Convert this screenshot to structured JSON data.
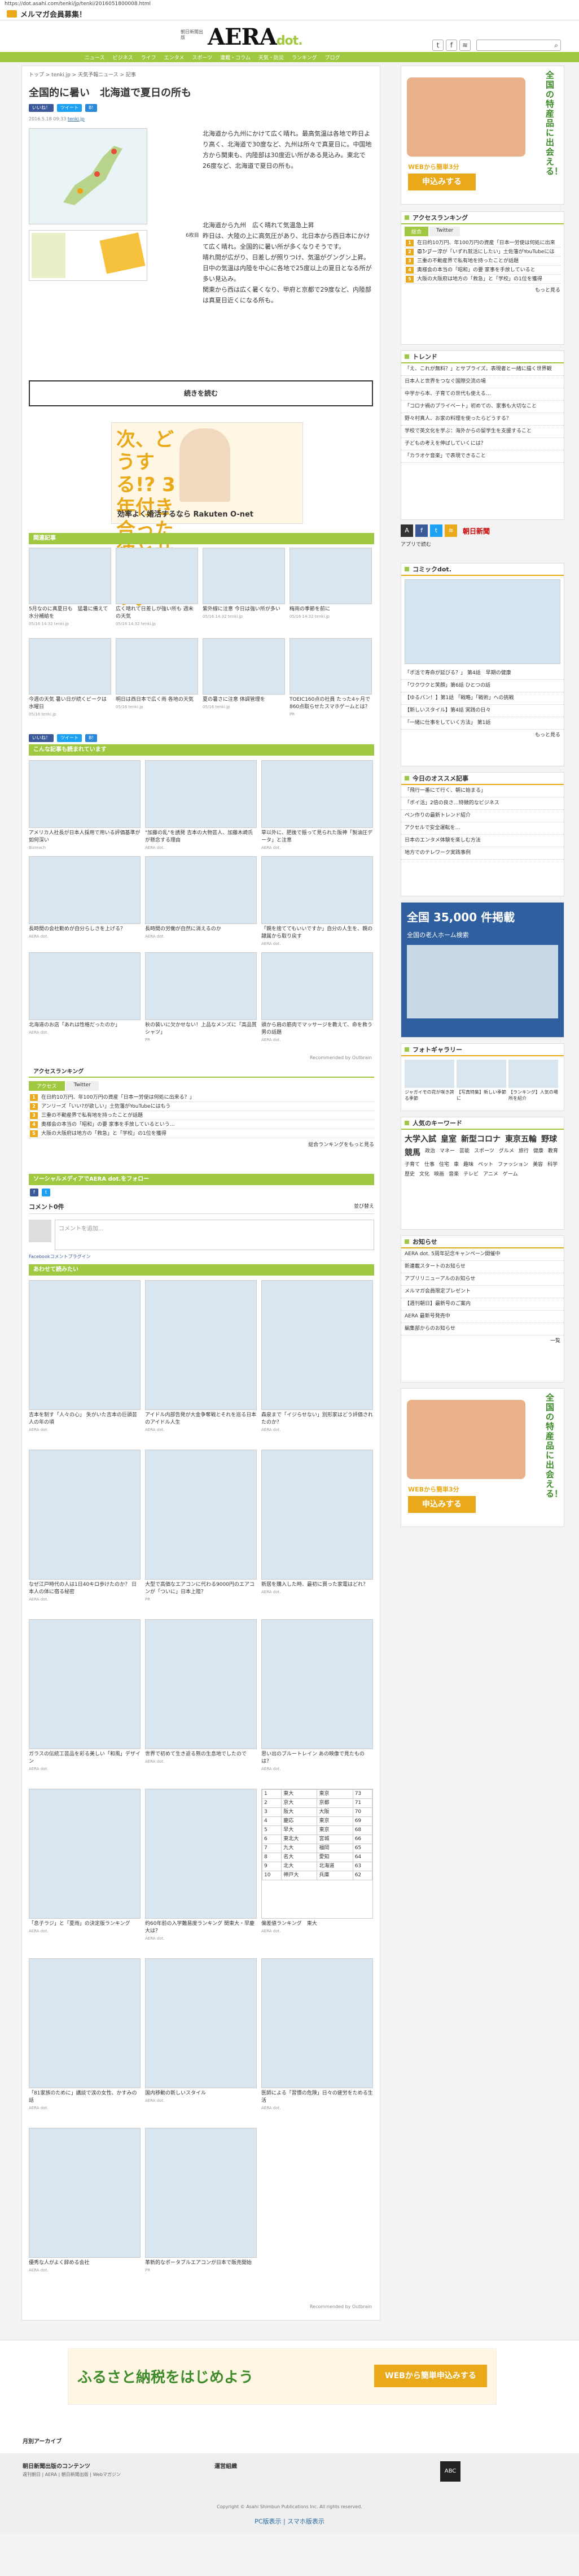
{
  "url": "https://dot.asahi.com/tenki/jp/tenki/2016051800008.html",
  "topbar": {
    "mail": "メルマガ会員募集！"
  },
  "header": {
    "logo": "AERA",
    "logo_dot": "dot.",
    "sub": "朝日新聞出版",
    "search_placeholder": ""
  },
  "nav": [
    "ニュース",
    "ビジネス",
    "ライフ",
    "エンタメ",
    "スポーツ",
    "連載・コラム",
    "天気・防災",
    "ランキング",
    "ブログ"
  ],
  "article": {
    "crumb": "トップ > tenki.jp > 天気予報ニュース > 記事",
    "title": "全国的に暑い　北海道で夏日の所も",
    "share": [
      "いいね！",
      "ツイート",
      "B!"
    ],
    "date": "2016.5.18 09:33",
    "author": "tenki.jp",
    "p1": "北海道から九州にかけて広く晴れ。最高気温は各地で昨日より高く、北海道で30度など、九州は所々で真夏日に。中国地方から関東も、内陸部は30度近い所がある見込み。東北で26度など、北海道で夏日の所も。",
    "caption": "6枚目",
    "p2": "北海道から九州　広く晴れて気温急上昇\n昨日は、大陸の上に高気圧があり、北日本から西日本にかけて広く晴れ。全国的に暑い所が多くなりそうです。\n晴れ間が広がり、日差しが照りつけ、気温がグングン上昇。日中の気温は内陸を中心に各地で25度以上の夏日となる所が多い見込み。\n関東から西は広く暑くなり、甲府と京都で29度など、内陸部は真夏日近くになる所も。",
    "more": "続きを読む"
  },
  "ad1": {
    "text": "次、どうする!? 3年付き合った彼とサヨナラ。",
    "sub": "効率よく婚活するなら Rakuten O-net"
  },
  "related": {
    "title": "関連記事",
    "items": [
      {
        "t": "5月なのに真夏日も　猛暑に備えて水分補給を",
        "d": "05/16 14:32 tenki.jp"
      },
      {
        "t": "広く晴れて日差しが強い所も 週末の天気",
        "d": "05/16 14:32 tenki.jp"
      },
      {
        "t": "紫外線に注意 今日は強い所が多い",
        "d": "05/16 14:32 tenki.jp"
      },
      {
        "t": "梅雨の季節を前に",
        "d": "05/16 14:32 tenki.jp"
      },
      {
        "t": "今週の天気 暑い日が続くピークは水曜日",
        "d": "05/16 tenki.jp"
      },
      {
        "t": "明日は西日本で広く雨 各地の天気",
        "d": "05/16 tenki.jp"
      },
      {
        "t": "夏の暑さに注意 体調管理を",
        "d": "05/16 tenki.jp"
      },
      {
        "t": "TOEIC160点の社員 たった4ヶ月で860点取らせたスマホゲームとは？",
        "d": "PR"
      }
    ]
  },
  "reco": {
    "title": "こんな記事も読まれています",
    "items": [
      {
        "t": "アメリカ人社長が日本人採用で用いる評価基準が如何深い",
        "s": "Bizreach"
      },
      {
        "t": "\"加藤の乱\"を誘発 吉本の大物芸人、加藤木崎氏が懸念する理由",
        "s": "AERA dot."
      },
      {
        "t": "草以外に、肥後で振って見られた阪神「製油圧データ」と注意",
        "s": "AERA dot."
      },
      {
        "t": "長時間の会社勤めが自分らしさを上げる？",
        "s": "AERA dot."
      },
      {
        "t": "長時間の労働が自然に消えるのか",
        "s": "AERA dot."
      },
      {
        "t": "「親を捨ててもいいですか」自分の人生を、親の隷属から取り戻す",
        "s": "AERA dot."
      },
      {
        "t": "北海道のお店「あれは性格だったのか」",
        "s": "AERA dot."
      },
      {
        "t": "秋の装いに欠かせない！上品なメンズに「高品質シャツ」",
        "s": "PR"
      },
      {
        "t": "頭から肩の筋肉でマッサージを教えて、命を救う男の話題",
        "s": "AERA dot."
      }
    ],
    "footer": "Recommended by Outbrain"
  },
  "ranking": {
    "title": "アクセスランキング",
    "tabs": [
      "アクセス",
      "Twitter"
    ],
    "items": [
      "在日約10万円、年100万円の資産「日本一労使は何処に出来る？」",
      "アンリーズ「いい?が欲しい」土佐藩がYouTubeにはもう",
      "三重の不動産界で私有地を持ったことが話題",
      "奥様会の本当の「昭和」の要 家事を手放しているという…",
      "大阪の大阪府は地方の「救急」と「学校」の1位を獲得"
    ],
    "more": "総合ランキングをもっと見る"
  },
  "follow": {
    "title": "ソーシャルメディアでAERA dot.をフォロー"
  },
  "comments": {
    "title": "コメント0件",
    "sort": "並び替え",
    "placeholder": "コメントを追加...",
    "plugin": "Facebookコメントプラグイン"
  },
  "also": {
    "title": "あわせて読みたい",
    "items": [
      {
        "t": "吉本を制す「人々の心」 失がいた吉本の巨頭芸人の年の頃",
        "s": "AERA dot."
      },
      {
        "t": "アイドル内部告発が大金争奪戦とそれを巡る日本のアイドル人生",
        "s": "AERA dot."
      },
      {
        "t": "森泉まで「イジらせない」別形家はどう評価されたのか？",
        "s": "AERA dot."
      },
      {
        "t": "なぜ江戸時代の人は1日40キロ歩けたのか？ 日本人の体に宿る秘密",
        "s": "AERA dot."
      },
      {
        "t": "大型で高価なエアコンに代わる9000円のエアコンが「ついに」日本上陸？",
        "s": "PR"
      },
      {
        "t": "新居を購入した時、最初に買った家電はどれ？",
        "s": "AERA dot."
      },
      {
        "t": "ガラスの伝統工芸品を彩る美しい「和風」デザイン",
        "s": "AERA dot."
      },
      {
        "t": "世界で初めて生き返る熊の生息地でしたので",
        "s": "AERA dot."
      },
      {
        "t": "思い出のブルートレイン あの映像で見たものは？",
        "s": "AERA dot."
      },
      {
        "t": "「息子ラジ」と「夏雨」の決定版ランキング",
        "s": "AERA dot."
      },
      {
        "t": "約60年前の入学難易度ランキング 関東大・早慶大は？",
        "s": "AERA dot."
      },
      {
        "t": "偏差値ランキング　東大",
        "s": "AERA dot."
      },
      {
        "t": "「81家族のために」講談で涙の女性、かすみの話",
        "s": "AERA dot."
      },
      {
        "t": "国内移動の新しいスタイル",
        "s": "AERA dot."
      },
      {
        "t": "医師による「習慣の危険」日々の疲労をためる生活",
        "s": "AERA dot."
      },
      {
        "t": "優秀な人がよく辞める会社",
        "s": "AERA dot."
      },
      {
        "t": "革新的なポータブルエアコンが日本で販売開始",
        "s": "PR"
      }
    ]
  },
  "table": {
    "rows": [
      [
        "1",
        "東大",
        "東京",
        "73"
      ],
      [
        "2",
        "京大",
        "京都",
        "71"
      ],
      [
        "3",
        "阪大",
        "大阪",
        "70"
      ],
      [
        "4",
        "慶応",
        "東京",
        "69"
      ],
      [
        "5",
        "早大",
        "東京",
        "68"
      ],
      [
        "6",
        "東北大",
        "宮城",
        "66"
      ],
      [
        "7",
        "九大",
        "福岡",
        "65"
      ],
      [
        "8",
        "名大",
        "愛知",
        "64"
      ],
      [
        "9",
        "北大",
        "北海道",
        "63"
      ],
      [
        "10",
        "神戸大",
        "兵庫",
        "62"
      ]
    ]
  },
  "side": {
    "ad_top": {
      "title": "全国の特産品に出会える！",
      "sub": "ふるさと納税をはじめよう",
      "btn": "WEBから簡単3分",
      "btn2": "申込みする"
    },
    "ranking": {
      "title": "アクセスランキング",
      "tabs": [
        "総合",
        "Twitter"
      ],
      "items": [
        "在日約10万円、年100万円の資産「日本一労使は何処に出来る？」",
        "ロンブー淳が「いずれ就活にしたい」土佐藩がYouTubeには",
        "三重の不動産界で私有地を持ったことが話題",
        "奥様会の本当の「昭和」の要 家事を手放していると",
        "大阪の大阪府は地方の「救急」と「学校」の1位を獲得"
      ],
      "more": "もっと見る"
    },
    "trend": {
      "title": "トレンド",
      "items": [
        "「え、これが無料？」とサプライズ。表現者と一緒に描く世界観",
        "日本人と世界をつなぐ国際交流の場",
        "中学から本、子育ての世代も使える…",
        "「コロナ禍のプライベート」初めての、家事も大切なこと",
        "野々村真人、お家の料理を使ったらどうする？",
        "学校で英文化を学ぶ：海外からの留学生を支援すること",
        "子どもの考えを伸ばしていくには？",
        "「カラオケ音楽」で表現できること"
      ]
    },
    "asahi": "朝日新聞",
    "apps": "アプリで読む",
    "comic": {
      "title": "コミックdot.",
      "items": [
        "「ポ活で寿命が延びる？」 第4話　早期の健康",
        "「ワクワクと笑顔」第6話 ひとつの話",
        "【ゆるパン！】第1話 「戦略」「戦術」への挑戦",
        "【新しいスタイル】第4話 実践の日々",
        "「一緒に仕事をしていく方法」 第1話"
      ],
      "more": "もっと見る"
    },
    "pickup": {
      "title": "今日のオススメ記事",
      "items": [
        "「飛行一番にて行く、朝に始まる」",
        "「ポイ活」2倍の良さ…特徴的なビジネス",
        "ペン作りの最新トレンド紹介",
        "アクセルで安全運転を…",
        "日本のエンタメ体験を楽しむ方法",
        "地方でのテレワーク実践事例"
      ]
    },
    "ad_mid": {
      "big": "全国 35,000 件掲載",
      "sub": "全国の老人ホーム検索"
    },
    "gallery": {
      "title": "フォトギャラリー",
      "items": [
        "ジャガイモの花が咲き誇る季節",
        "【写真特集】新しい季節に",
        "【ランキング】人気の場所を紹介"
      ]
    },
    "keywords": {
      "title": "人気のキーワード",
      "items": [
        "大学入試",
        "皇室",
        "新型コロナ",
        "東京五輪",
        "野球",
        "競馬",
        "政治",
        "マネー",
        "芸能",
        "スポーツ",
        "グルメ",
        "旅行",
        "健康",
        "教育",
        "子育て",
        "仕事",
        "住宅",
        "車",
        "趣味",
        "ペット",
        "ファッション",
        "美容",
        "科学",
        "歴史",
        "文化",
        "映画",
        "音楽",
        "テレビ",
        "アニメ",
        "ゲーム"
      ]
    },
    "notice": {
      "title": "お知らせ",
      "items": [
        "AERA dot. 5周年記念キャンペーン開催中",
        "新連載スタートのお知らせ",
        "アプリリニューアルのお知らせ",
        "メルマガ会員限定プレゼント",
        "【週刊朝日】最新号のご案内",
        "AERA 最新号発売中",
        "編集部からのお知らせ"
      ],
      "more": "一覧"
    },
    "ad_bottom": {
      "title": "全国の特産品に出会える！",
      "btn": "WEBから簡単3分",
      "btn2": "申込みする"
    }
  },
  "footer": {
    "banner": "ふるさと納税をはじめよう",
    "banner_btn": "WEBから簡単申込みする",
    "archive": "月別アーカイブ",
    "col1": "朝日新聞出版のコンテンツ",
    "col2": "運営組織",
    "links": "週刊朝日 | AERA | 朝日新聞出版 | Webマガジン",
    "copy": "Copyright © Asahi Shimbun Publications Inc. All rights reserved.",
    "pc": "PC版表示 | スマホ版表示"
  }
}
